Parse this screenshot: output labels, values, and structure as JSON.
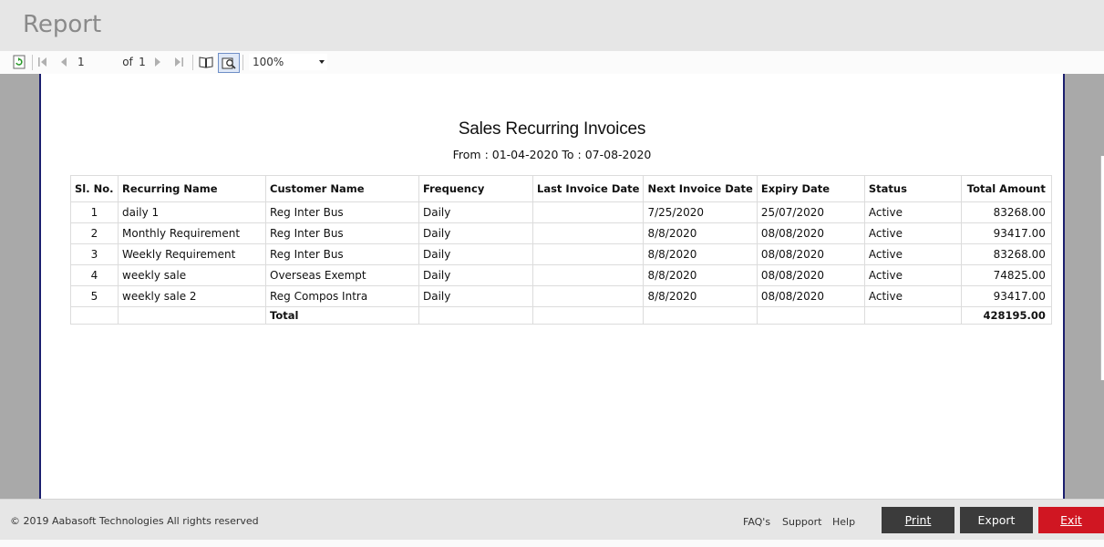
{
  "window": {
    "title": "Report"
  },
  "toolbar": {
    "page_current": "1",
    "page_of_label": "of",
    "page_total": "1",
    "zoom": "100%"
  },
  "report": {
    "title": "Sales Recurring Invoices",
    "subtitle": "From : 01-04-2020 To : 07-08-2020",
    "columns": [
      "Sl. No.",
      "Recurring Name",
      "Customer Name",
      "Frequency",
      "Last Invoice Date",
      "Next Invoice Date",
      "Expiry Date",
      "Status",
      "Total Amount"
    ],
    "rows": [
      [
        "1",
        "daily 1",
        "Reg Inter Bus",
        "Daily",
        "",
        "7/25/2020",
        "25/07/2020",
        "Active",
        "83268.00"
      ],
      [
        "2",
        "Monthly Requirement",
        "Reg Inter Bus",
        "Daily",
        "",
        "8/8/2020",
        "08/08/2020",
        "Active",
        "93417.00"
      ],
      [
        "3",
        "Weekly Requirement",
        "Reg Inter Bus",
        "Daily",
        "",
        "8/8/2020",
        "08/08/2020",
        "Active",
        "83268.00"
      ],
      [
        "4",
        "weekly sale",
        "Overseas Exempt",
        "Daily",
        "",
        "8/8/2020",
        "08/08/2020",
        "Active",
        "74825.00"
      ],
      [
        "5",
        "weekly sale 2",
        "Reg Compos Intra",
        "Daily",
        "",
        "8/8/2020",
        "08/08/2020",
        "Active",
        "93417.00"
      ]
    ],
    "total_label": "Total",
    "total_amount": "428195.00"
  },
  "footer": {
    "copyright": "© 2019 Aabasoft Technologies All rights reserved",
    "links": [
      "FAQ's",
      "Support",
      "Help"
    ],
    "print_label": "Print",
    "export_label": "Export",
    "exit_label": "Exit"
  }
}
